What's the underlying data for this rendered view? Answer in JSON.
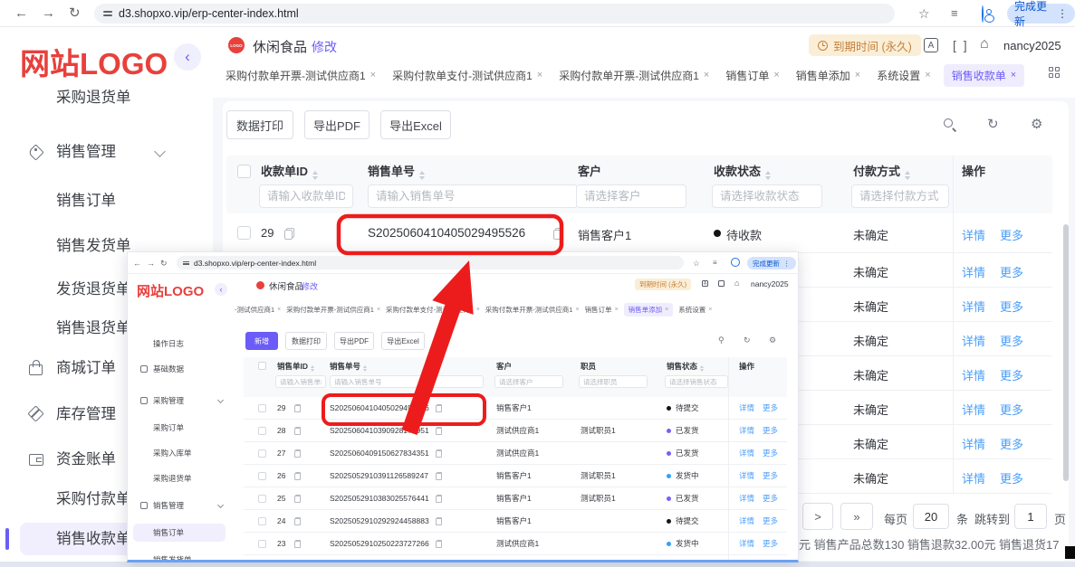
{
  "chrome": {
    "url": "d3.shopxo.vip/erp-center-index.html",
    "update_button": "完成更新"
  },
  "main": {
    "sidebar": {
      "logo": "网站LOGO",
      "items": [
        {
          "label": "采购退货单"
        },
        {
          "label": "销售管理"
        },
        {
          "label": "销售订单"
        },
        {
          "label": "销售发货单"
        },
        {
          "label": "发货退货单"
        },
        {
          "label": "销售退货单"
        },
        {
          "label": "商城订单"
        },
        {
          "label": "库存管理"
        },
        {
          "label": "资金账单"
        },
        {
          "label": "采购付款单"
        },
        {
          "label": "销售收款单"
        }
      ]
    },
    "header": {
      "shop_badge": "LOGO",
      "shop_name": "休闲食品",
      "edit_link": "修改",
      "expire_badge": "到期时间 (永久)",
      "username": "nancy2025"
    },
    "tabs": [
      {
        "label": "采购付款单开票-测试供应商1",
        "close": "×"
      },
      {
        "label": "采购付款单支付-测试供应商1",
        "close": "×"
      },
      {
        "label": "采购付款单开票-测试供应商1",
        "close": "×"
      },
      {
        "label": "销售订单",
        "close": "×"
      },
      {
        "label": "销售单添加",
        "close": "×"
      },
      {
        "label": "系统设置",
        "close": "×"
      },
      {
        "label": "销售收款单",
        "close": "×"
      }
    ],
    "toolbar": {
      "print": "数据打印",
      "pdf": "导出PDF",
      "excel": "导出Excel"
    },
    "table": {
      "cols": {
        "id": "收款单ID",
        "order_no": "销售单号",
        "customer": "客户",
        "receipt_status": "收款状态",
        "pay_method": "付款方式",
        "action": "操作"
      },
      "filters": {
        "id": "请输入收款单ID",
        "order_no": "请输入销售单号",
        "customer": "请选择客户",
        "receipt_status": "请选择收款状态",
        "pay_method": "请选择付款方式"
      },
      "row1": {
        "id": "29",
        "order_no": "S2025060410405029495526",
        "customer": "销售客户1",
        "status": "待收款",
        "status_color": "#141414",
        "pay_method": "未确定",
        "detail": "详情",
        "more": "更多"
      },
      "covered_rows": [
        {
          "pay_method": "未确定",
          "detail": "详情",
          "more": "更多"
        },
        {
          "pay_method": "未确定",
          "detail": "详情",
          "more": "更多"
        },
        {
          "pay_method": "未确定",
          "detail": "详情",
          "more": "更多"
        },
        {
          "pay_method": "未确定",
          "detail": "详情",
          "more": "更多"
        },
        {
          "pay_method": "未确定",
          "detail": "详情",
          "more": "更多"
        },
        {
          "pay_method": "未确定",
          "detail": "详情",
          "more": "更多"
        },
        {
          "pay_method": "未确定",
          "detail": "详情",
          "more": "更多"
        }
      ]
    },
    "pagination": {
      "next": ">",
      "last": "»",
      "per_label": "每页",
      "per_value": "20",
      "per_unit": "条",
      "jump_label": "跳转到",
      "jump_value": "1",
      "jump_unit": "页"
    },
    "stats": "元   销售产品总数130   销售退款32.00元   销售退货17"
  },
  "overlay": {
    "chrome": {
      "url": "d3.shopxo.vip/erp-center-index.html",
      "update_button": "完成更新"
    },
    "sidebar": {
      "logo": "网站LOGO",
      "items": [
        {
          "label": "操作日志"
        },
        {
          "label": "基础数据"
        },
        {
          "label": "采购管理"
        },
        {
          "label": "采购订单"
        },
        {
          "label": "采购入库单"
        },
        {
          "label": "采购退货单"
        },
        {
          "label": "销售管理"
        },
        {
          "label": "销售订单"
        },
        {
          "label": "销售发货单"
        }
      ]
    },
    "header": {
      "shop_name": "休闲食品",
      "edit_link": "修改",
      "expire_badge": "到期时间 (永久)",
      "username": "nancy2025"
    },
    "tabs": [
      {
        "label": "-测试供应商1",
        "close": "×"
      },
      {
        "label": "采购付款单开票-测试供应商1",
        "close": "×"
      },
      {
        "label": "采购付款单支付-测试供应商1",
        "close": "×"
      },
      {
        "label": "采购付款单开票-测试供应商1",
        "close": "×"
      },
      {
        "label": "销售订单",
        "close": "×"
      },
      {
        "label": "销售单添加",
        "close": "×"
      },
      {
        "label": "系统设置",
        "close": "×"
      }
    ],
    "toolbar": {
      "add": "新增",
      "print": "数据打印",
      "pdf": "导出PDF",
      "excel": "导出Excel"
    },
    "table": {
      "cols": {
        "id": "销售单ID",
        "order_no": "销售单号",
        "customer": "客户",
        "staff": "职员",
        "status": "销售状态",
        "action": "操作"
      },
      "filters": {
        "id": "请输入销售单ID",
        "order_no": "请输入销售单号",
        "customer": "请选择客户",
        "staff": "请选择职员",
        "status": "请选择销售状态"
      },
      "rows": [
        {
          "id": "29",
          "order_no": "S2025060410405029495526",
          "customer": "销售客户1",
          "staff": "",
          "status": "待提交",
          "status_color": "#141414",
          "detail": "详情",
          "more": "更多"
        },
        {
          "id": "28",
          "order_no": "S2025060410390928174951",
          "customer": "测试供应商1",
          "staff": "测试职员1",
          "status": "已发货",
          "status_color": "#7c5cfa",
          "detail": "详情",
          "more": "更多"
        },
        {
          "id": "27",
          "order_no": "S2025060409150627834351",
          "customer": "测试供应商1",
          "staff": "",
          "status": "已发货",
          "status_color": "#7c5cfa",
          "detail": "详情",
          "more": "更多"
        },
        {
          "id": "26",
          "order_no": "S2025052910391126589247",
          "customer": "销售客户1",
          "staff": "测试职员1",
          "status": "发货中",
          "status_color": "#31a0fd",
          "detail": "详情",
          "more": "更多"
        },
        {
          "id": "25",
          "order_no": "S2025052910383025576441",
          "customer": "销售客户1",
          "staff": "测试职员1",
          "status": "已发货",
          "status_color": "#7c5cfa",
          "detail": "详情",
          "more": "更多"
        },
        {
          "id": "24",
          "order_no": "S2025052910292924458883",
          "customer": "销售客户1",
          "staff": "",
          "status": "待提交",
          "status_color": "#141414",
          "detail": "详情",
          "more": "更多"
        },
        {
          "id": "23",
          "order_no": "S2025052910250223727266",
          "customer": "测试供应商1",
          "staff": "",
          "status": "发货中",
          "status_color": "#31a0fd",
          "detail": "详情",
          "more": "更多"
        }
      ]
    }
  },
  "annotations": {
    "red": "#ed1c1c",
    "boxed_value": "S2025060410405029495526"
  },
  "colors": {
    "accent_purple": "#6c5cf7",
    "link_blue": "#4a9efa",
    "logo_red": "#e8403c",
    "expire_badge_bg": "#fbeed7",
    "expire_badge_text": "#c5803a",
    "status_black": "#141414",
    "status_purple": "#7c5cfa",
    "status_blue": "#31a0fd"
  }
}
